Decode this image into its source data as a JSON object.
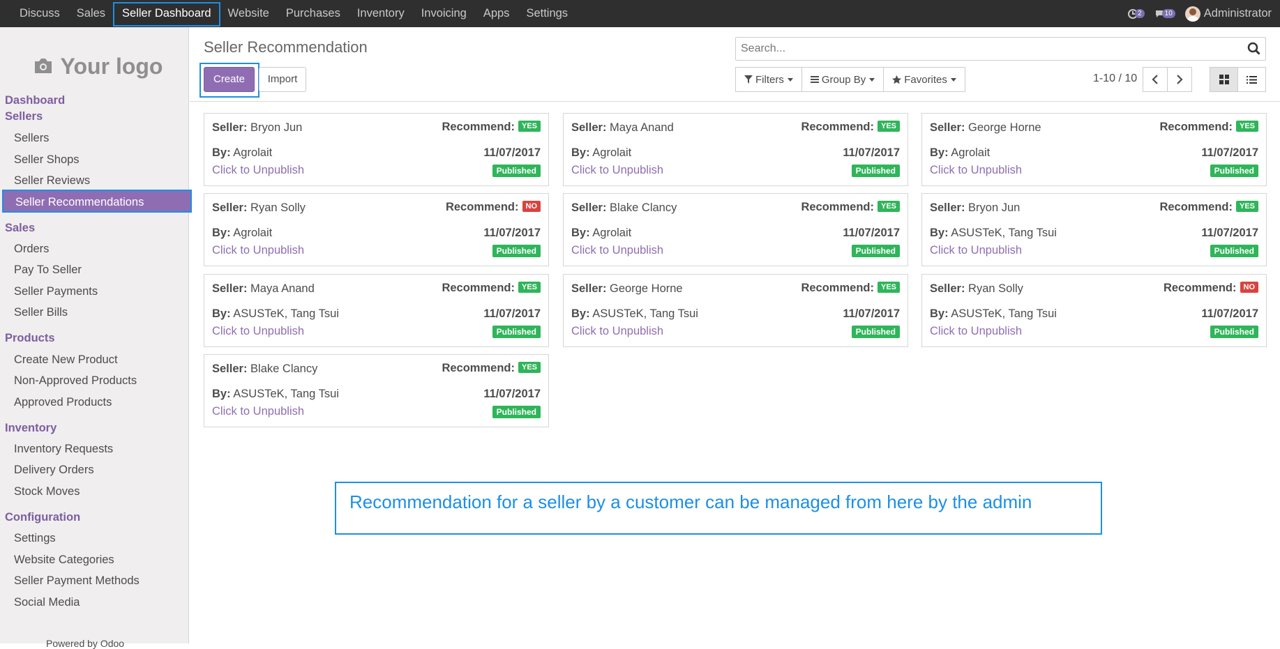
{
  "topbar": {
    "menus": [
      "Discuss",
      "Sales",
      "Seller Dashboard",
      "Website",
      "Purchases",
      "Inventory",
      "Invoicing",
      "Apps",
      "Settings"
    ],
    "activity_count": "2",
    "message_count": "10",
    "user_name": "Administrator"
  },
  "sidebar": {
    "logo_text": "Your logo",
    "sections": [
      {
        "title": "Dashboard",
        "items": []
      },
      {
        "title": "Sellers",
        "items": [
          "Sellers",
          "Seller Shops",
          "Seller Reviews",
          "Seller Recommendations"
        ]
      },
      {
        "title": "Sales",
        "items": [
          "Orders",
          "Pay To Seller",
          "Seller Payments",
          "Seller Bills"
        ]
      },
      {
        "title": "Products",
        "items": [
          "Create New Product",
          "Non-Approved Products",
          "Approved Products"
        ]
      },
      {
        "title": "Inventory",
        "items": [
          "Inventory Requests",
          "Delivery Orders",
          "Stock Moves"
        ]
      },
      {
        "title": "Configuration",
        "items": [
          "Settings",
          "Website Categories",
          "Seller Payment Methods",
          "Social Media"
        ]
      }
    ],
    "active_item": "Seller Recommendations",
    "powered_by": "Powered by Odoo"
  },
  "control_panel": {
    "title": "Seller Recommendation",
    "create_label": "Create",
    "import_label": "Import",
    "search_placeholder": "Search...",
    "filters_label": "Filters",
    "groupby_label": "Group By",
    "favorites_label": "Favorites",
    "pager": "1-10 / 10"
  },
  "card_labels": {
    "seller": "Seller:",
    "recommend": "Recommend:",
    "by": "By:",
    "unpublish": "Click to Unpublish",
    "published": "Published"
  },
  "cards": [
    {
      "seller": "Bryon Jun",
      "recommend": "YES",
      "by": "Agrolait",
      "date": "11/07/2017"
    },
    {
      "seller": "Maya Anand",
      "recommend": "YES",
      "by": "Agrolait",
      "date": "11/07/2017"
    },
    {
      "seller": "George Horne",
      "recommend": "YES",
      "by": "Agrolait",
      "date": "11/07/2017"
    },
    {
      "seller": "Ryan Solly",
      "recommend": "NO",
      "by": "Agrolait",
      "date": "11/07/2017"
    },
    {
      "seller": "Blake Clancy",
      "recommend": "YES",
      "by": "Agrolait",
      "date": "11/07/2017"
    },
    {
      "seller": "Bryon Jun",
      "recommend": "YES",
      "by": "ASUSTeK, Tang Tsui",
      "date": "11/07/2017"
    },
    {
      "seller": "Maya Anand",
      "recommend": "YES",
      "by": "ASUSTeK, Tang Tsui",
      "date": "11/07/2017"
    },
    {
      "seller": "George Horne",
      "recommend": "YES",
      "by": "ASUSTeK, Tang Tsui",
      "date": "11/07/2017"
    },
    {
      "seller": "Ryan Solly",
      "recommend": "NO",
      "by": "ASUSTeK, Tang Tsui",
      "date": "11/07/2017"
    },
    {
      "seller": "Blake Clancy",
      "recommend": "YES",
      "by": "ASUSTeK, Tang Tsui",
      "date": "11/07/2017"
    }
  ],
  "callout": "Recommendation for a seller by a customer can be managed from here by the admin",
  "colors": {
    "brand": "#8f6db3",
    "accent": "#7c5ea0",
    "highlight": "#1c8fe6",
    "yes": "#2fb55a",
    "no": "#d9433f"
  }
}
